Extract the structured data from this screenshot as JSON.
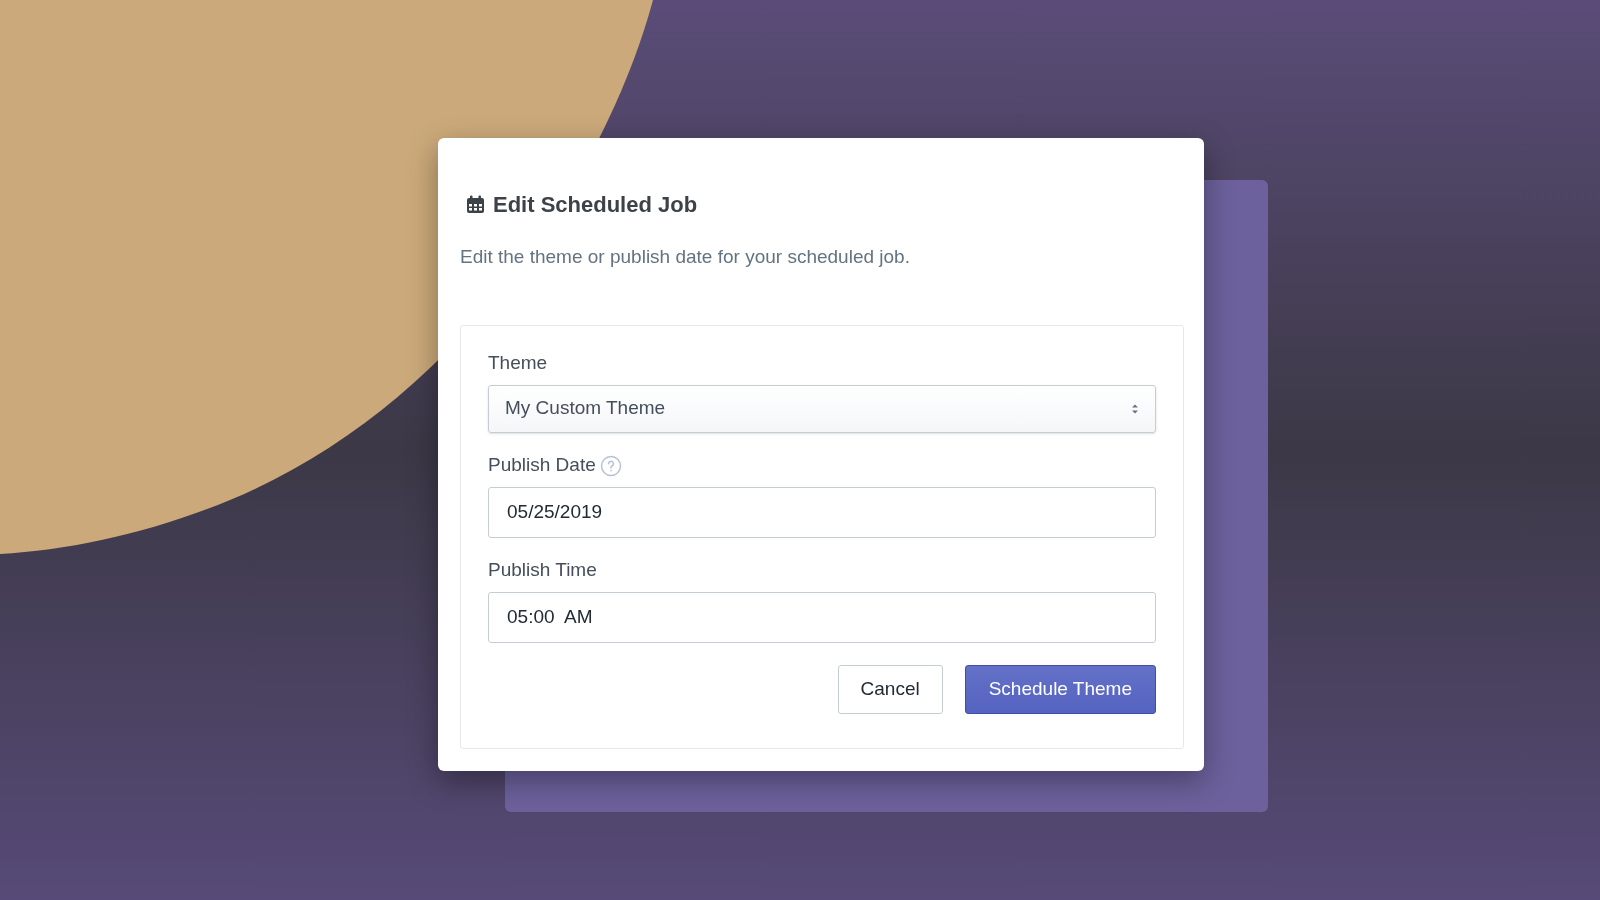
{
  "dialog": {
    "title": "Edit Scheduled Job",
    "description": "Edit the theme or publish date for your scheduled job."
  },
  "fields": [
    {
      "kind": "select",
      "label": "Theme",
      "value": "My Custom Theme",
      "help": false
    },
    {
      "kind": "input",
      "label": "Publish Date",
      "value": "05/25/2019",
      "help": true
    },
    {
      "kind": "input",
      "label": "Publish Time",
      "value": "05:00  AM",
      "help": false
    }
  ],
  "buttons": [
    {
      "label": "Cancel",
      "kind": "secondary"
    },
    {
      "label": "Schedule Theme",
      "kind": "primary"
    }
  ]
}
